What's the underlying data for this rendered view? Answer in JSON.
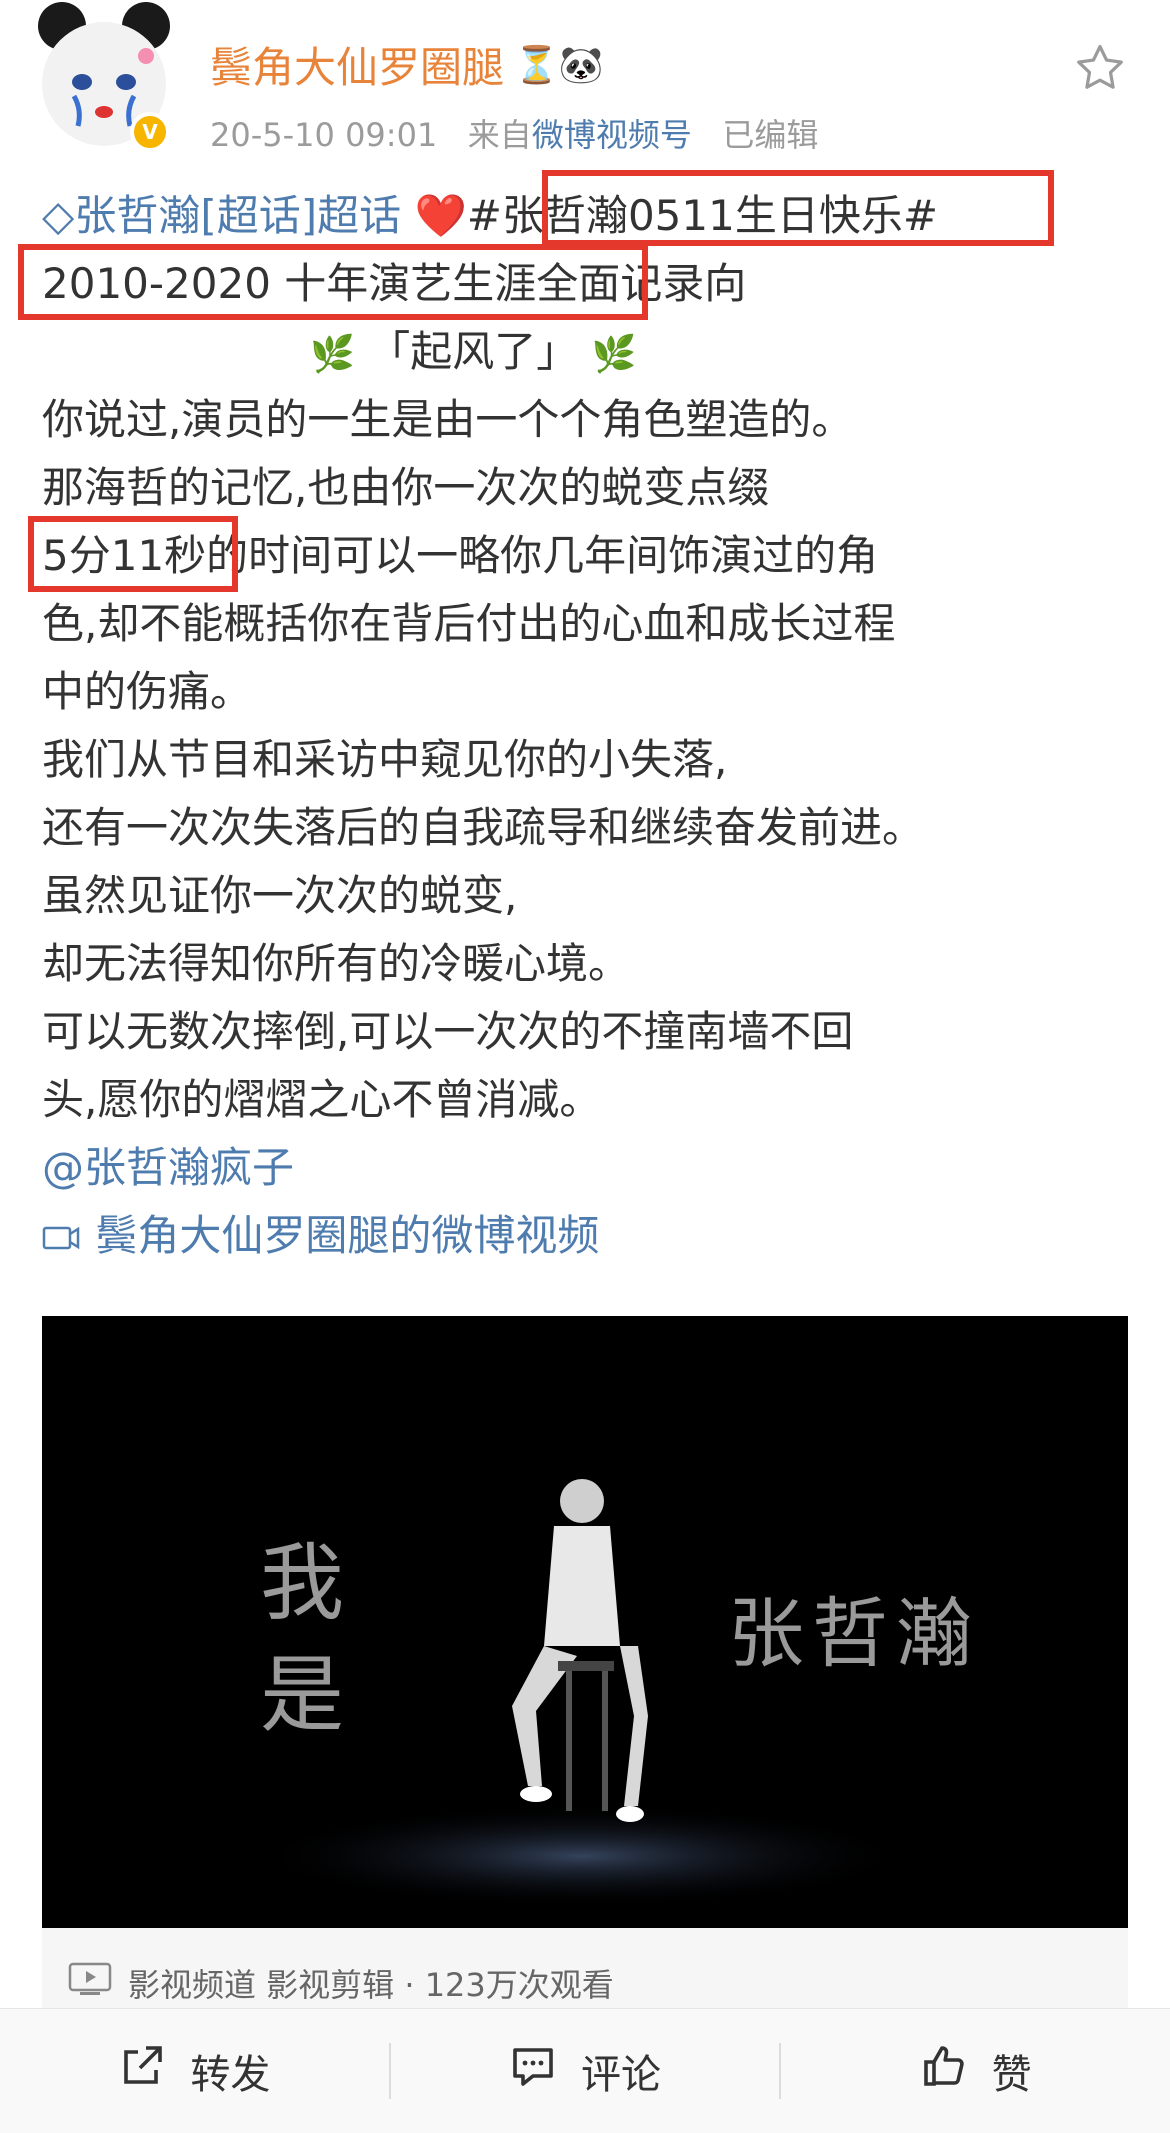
{
  "header": {
    "username": "鬓角大仙罗圈腿",
    "username_emojis": "⏳🐼",
    "verified_mark": "V",
    "time": "20-5-10 09:01",
    "from_label": "来自",
    "source": "微博视频号",
    "edited": "已编辑",
    "star_icon": "star-icon"
  },
  "post": {
    "supertopic": "张哲瀚[超话]超话",
    "heart": "❤️",
    "hashtag": "#张哲瀚0511生日快乐#",
    "line2": "2010-2020 十年演艺生涯全面记录向",
    "leaf": "🌿",
    "title": "「起风了」",
    "line4": "你说过,演员的一生是由一个个角色塑造的。",
    "line5": "那海哲的记忆,也由你一次次的蜕变点缀",
    "duration": "5分11秒",
    "line6_rest": "的时间可以一略你几年间饰演过的角",
    "line7": "色,却不能概括你在背后付出的心血和成长过程",
    "line8": "中的伤痛。",
    "line9": "我们从节目和采访中窥见你的小失落,",
    "line10": "还有一次次失落后的自我疏导和继续奋发前进。",
    "line11": "虽然见证你一次次的蜕变,",
    "line12": "却无法得知你所有的冷暖心境。",
    "line13": "可以无数次摔倒,可以一次次的不撞南墙不回",
    "line14": "头,愿你的熠熠之心不曾消减。",
    "mention": "@张哲瀚疯子",
    "video_link": "鬓角大仙罗圈腿的微博视频"
  },
  "video": {
    "left_text_1": "我",
    "left_text_2": "是",
    "right_text": "张哲瀚",
    "meta": "影视频道 影视剪辑 · 123万次观看"
  },
  "toolbar": {
    "repost": "转发",
    "comment": "评论",
    "like": "赞"
  },
  "colors": {
    "username": "#e8833a",
    "link": "#4f7cae",
    "highlight": "#e4382d"
  }
}
